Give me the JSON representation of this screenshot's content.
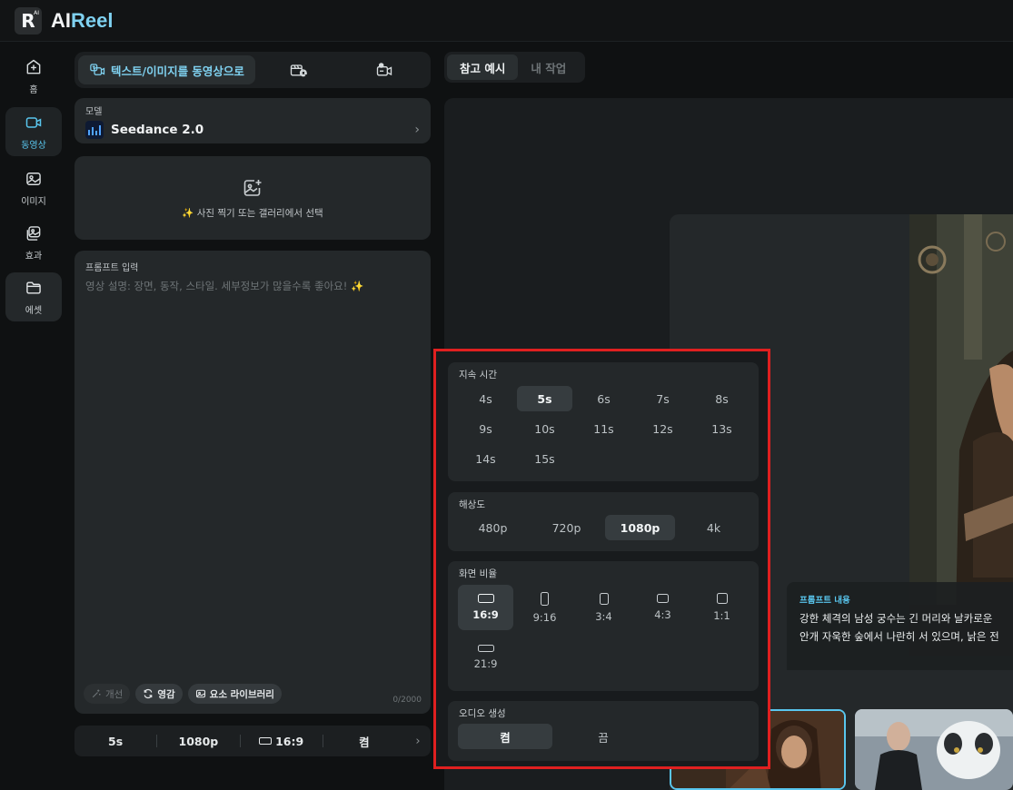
{
  "header": {
    "brand_prefix": "AI",
    "brand_suffix": "Reel",
    "logo_letter": "R",
    "logo_mini": "AI"
  },
  "nav": [
    {
      "label": "홈",
      "icon": "home-icon"
    },
    {
      "label": "동영상",
      "icon": "video-icon",
      "active": true
    },
    {
      "label": "이미지",
      "icon": "image-icon"
    },
    {
      "label": "효과",
      "icon": "effects-icon"
    },
    {
      "label": "에셋",
      "icon": "folder-icon"
    }
  ],
  "mode_tabs": {
    "active_label": "텍스트/이미지를 동영상으로"
  },
  "model": {
    "label": "모델",
    "name": "Seedance 2.0"
  },
  "upload": {
    "hint": "✨ 사진 찍기 또는 갤러리에서 선택"
  },
  "prompt": {
    "label": "프롬프트 입력",
    "placeholder": "영상 설명: 장면, 동작, 스타일. 세부정보가 많을수록 좋아요! ✨",
    "counter": "0/2000",
    "tools": {
      "improve": "개선",
      "inspire": "영감",
      "library": "요소 라이브러리"
    }
  },
  "summary_bar": {
    "duration": "5s",
    "resolution": "1080p",
    "ratio": "16:9",
    "audio": "켬"
  },
  "right_tabs": {
    "examples": "참고 예시",
    "my_work": "내 작업"
  },
  "preview": {
    "prompt_label": "프롬프트 내용",
    "prompt_line1": "강한 체격의 남성 궁수는 긴 머리와 날카로운",
    "prompt_line2": "안개 자욱한 숲에서 나란히 서 있으며, 낡은 전"
  },
  "settings": {
    "duration": {
      "title": "지속 시간",
      "options": [
        "4s",
        "5s",
        "6s",
        "7s",
        "8s",
        "9s",
        "10s",
        "11s",
        "12s",
        "13s",
        "14s",
        "15s"
      ],
      "selected": "5s"
    },
    "resolution": {
      "title": "해상도",
      "options": [
        "480p",
        "720p",
        "1080p",
        "4k"
      ],
      "selected": "1080p"
    },
    "aspect": {
      "title": "화면 비율",
      "options": [
        "16:9",
        "9:16",
        "3:4",
        "4:3",
        "1:1",
        "21:9"
      ],
      "selected": "16:9"
    },
    "audio": {
      "title": "오디오 생성",
      "on": "켬",
      "off": "끔",
      "selected": "켬"
    }
  },
  "colors": {
    "accent": "#59c6ee",
    "highlight_frame": "#e02020"
  }
}
